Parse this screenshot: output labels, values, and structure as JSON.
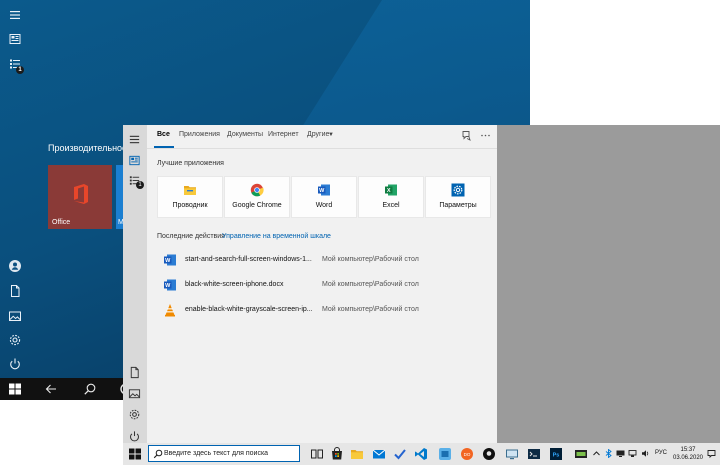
{
  "back_window": {
    "group_title": "Производительность",
    "tiles": [
      {
        "label": "Office",
        "icon": "office-icon"
      },
      {
        "label": "M",
        "icon": "mail-icon"
      }
    ],
    "badge_count": "1"
  },
  "search_panel": {
    "tabs": [
      {
        "label": "Все",
        "active": true
      },
      {
        "label": "Приложения"
      },
      {
        "label": "Документы"
      },
      {
        "label": "Интернет"
      },
      {
        "label": "Другие"
      }
    ],
    "top_apps_title": "Лучшие приложения",
    "top_apps": [
      {
        "name": "Проводник",
        "icon": "file-explorer-icon"
      },
      {
        "name": "Google Chrome",
        "icon": "chrome-icon"
      },
      {
        "name": "Word",
        "icon": "word-icon"
      },
      {
        "name": "Excel",
        "icon": "excel-icon"
      },
      {
        "name": "Параметры",
        "icon": "settings-icon"
      }
    ],
    "recent_title": "Последние действия",
    "timeline_link": "Управление на временной шкале",
    "recent": [
      {
        "name": "start-and-search-full-screen-windows-1...",
        "path": "Мой компьютер\\Рабочий стол",
        "icon": "word-doc-icon"
      },
      {
        "name": "black-white-screen-iphone.docx",
        "path": "Мой компьютер\\Рабочий стол",
        "icon": "word-doc-icon"
      },
      {
        "name": "enable-black-white-grayscale-screen-ip...",
        "path": "Мой компьютер\\Рабочий стол",
        "icon": "vlc-icon"
      }
    ],
    "badge_count": "1"
  },
  "taskbar": {
    "search_placeholder": "Введите здесь текст для поиска",
    "language": "РУС",
    "time": "15:37",
    "date": "03.06.2020"
  },
  "colors": {
    "accent": "#0063b1",
    "desktop_gray": "#9b9b9b",
    "back_blue": "#0a4f7d"
  }
}
